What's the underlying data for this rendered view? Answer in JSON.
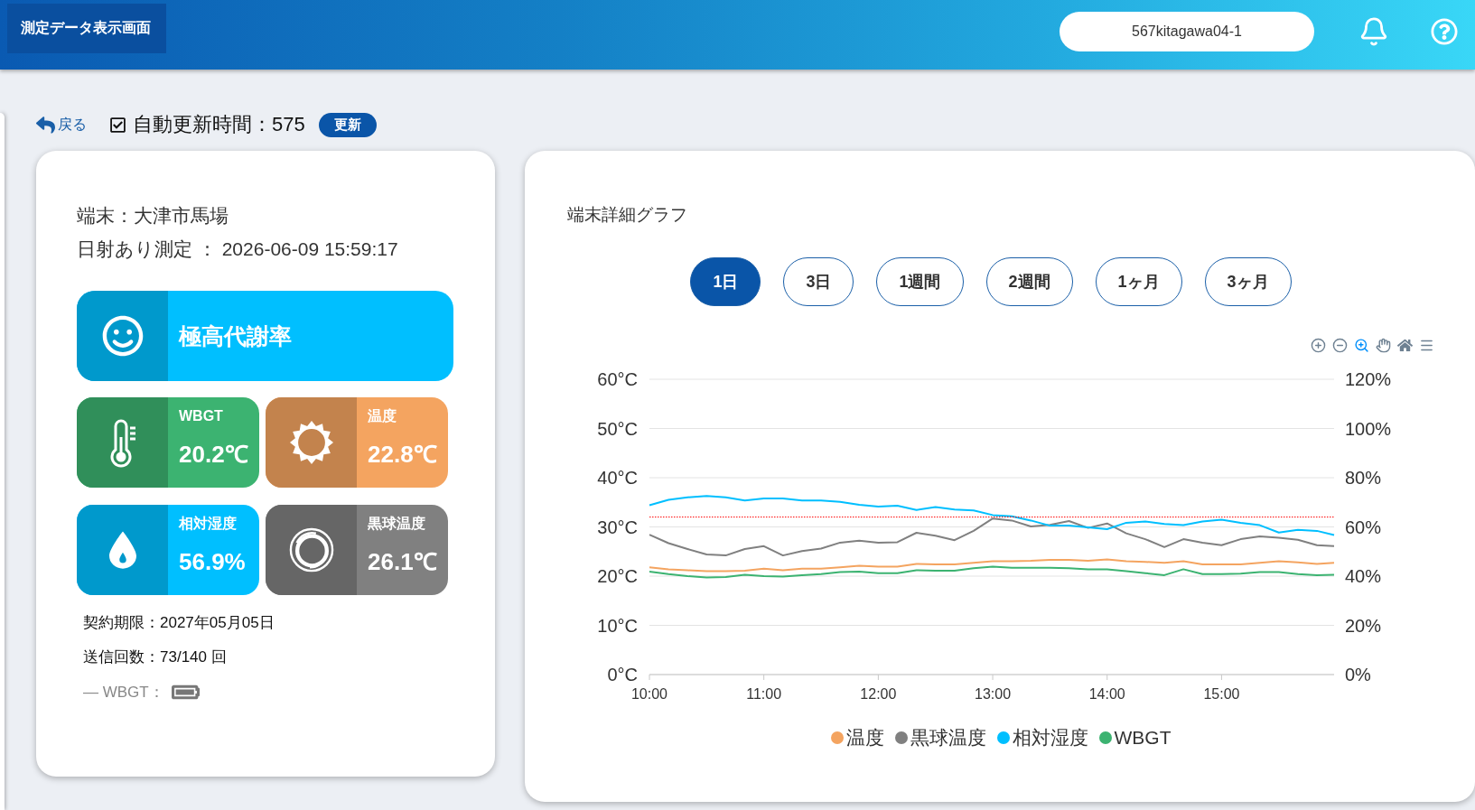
{
  "header": {
    "title": "測定データ表示画面",
    "user": "567kitagawa04-1"
  },
  "toolbar": {
    "back": "戻る",
    "auto_update": {
      "label": "自動更新時間：575",
      "checked": true
    },
    "refresh": "更新"
  },
  "device_card": {
    "lines": [
      "端末：大津市馬場",
      "日射あり測定 ： 2026-06-09 15:59:17"
    ],
    "status": {
      "label": "極高代謝率"
    },
    "metrics": [
      {
        "kind": "wbgt",
        "label": "WBGT",
        "value": "20.2℃",
        "color": "#3cb371"
      },
      {
        "kind": "temperature",
        "label": "温度",
        "value": "22.8℃",
        "color": "#f4a460"
      },
      {
        "kind": "humidity",
        "label": "相対湿度",
        "value": "56.9%",
        "color": "#00bfff"
      },
      {
        "kind": "globe",
        "label": "黒球温度",
        "value": "26.1℃",
        "color": "#808080"
      }
    ],
    "info": [
      "契約期限：2027年05月05日",
      "送信回数：73/140 回"
    ],
    "battery_label": "— WBGT："
  },
  "graph_card": {
    "title": "端末詳細グラフ",
    "ranges": [
      {
        "label": "1日",
        "selected": true
      },
      {
        "label": "3日",
        "selected": false
      },
      {
        "label": "1週間",
        "selected": false
      },
      {
        "label": "2週間",
        "selected": false
      },
      {
        "label": "1ヶ月",
        "selected": false
      },
      {
        "label": "3ヶ月",
        "selected": false
      }
    ],
    "tools": [
      {
        "kind": "zoom-in",
        "selected": false
      },
      {
        "kind": "zoom-out",
        "selected": false
      },
      {
        "kind": "zoom",
        "selected": true
      },
      {
        "kind": "pan",
        "selected": false
      },
      {
        "kind": "home",
        "selected": false
      },
      {
        "kind": "menu",
        "selected": false
      }
    ],
    "chart_data": {
      "type": "line",
      "x": [
        600,
        610,
        620,
        630,
        640,
        650,
        660,
        670,
        680,
        690,
        700,
        710,
        720,
        730,
        740,
        750,
        760,
        770,
        780,
        790,
        800,
        810,
        820,
        830,
        840,
        850,
        860,
        870,
        880,
        890,
        900,
        910,
        920,
        930,
        940,
        950,
        959
      ],
      "xlim": [
        600,
        959
      ],
      "xticks": [
        {
          "value": 600,
          "label": "10:00"
        },
        {
          "value": 660,
          "label": "11:00"
        },
        {
          "value": 720,
          "label": "12:00"
        },
        {
          "value": 780,
          "label": "13:00"
        },
        {
          "value": 840,
          "label": "14:00"
        },
        {
          "value": 900,
          "label": "15:00"
        }
      ],
      "ylim": [
        0,
        60
      ],
      "yticks": [
        {
          "value": 60,
          "label": "60°C"
        },
        {
          "value": 50,
          "label": "50°C"
        },
        {
          "value": 40,
          "label": "40°C"
        },
        {
          "value": 30,
          "label": "30°C"
        },
        {
          "value": 20,
          "label": "20°C"
        },
        {
          "value": 10,
          "label": "10°C"
        },
        {
          "value": 0,
          "label": "0°C"
        }
      ],
      "y2lim": [
        0,
        120
      ],
      "y2ticks": [
        {
          "value": 120,
          "label": "120%"
        },
        {
          "value": 100,
          "label": "100%"
        },
        {
          "value": 80,
          "label": "80%"
        },
        {
          "value": 60,
          "label": "60%"
        },
        {
          "value": 40,
          "label": "40%"
        },
        {
          "value": 20,
          "label": "20%"
        },
        {
          "value": 0,
          "label": "0%"
        }
      ],
      "grid": true,
      "legend": "bottom",
      "series": [
        {
          "name": "温度",
          "color": "#f4a460",
          "values": [
            21.8,
            21.4,
            21.2,
            21.0,
            21.0,
            21.1,
            21.5,
            21.2,
            21.5,
            21.5,
            21.8,
            22.1,
            21.9,
            21.9,
            22.5,
            22.4,
            22.4,
            22.7,
            23.0,
            23.0,
            23.1,
            23.3,
            23.3,
            23.1,
            23.4,
            23.0,
            22.9,
            22.7,
            23.0,
            22.4,
            22.4,
            22.4,
            22.7,
            23.0,
            22.8,
            22.5,
            22.7
          ]
        },
        {
          "name": "黒球温度",
          "color": "#808080",
          "values": [
            28.4,
            26.7,
            25.5,
            24.4,
            24.2,
            25.5,
            26.1,
            24.2,
            25.1,
            25.6,
            26.8,
            27.2,
            26.8,
            26.9,
            28.8,
            28.2,
            27.3,
            29.2,
            31.7,
            31.3,
            30.1,
            30.4,
            31.2,
            29.8,
            30.7,
            28.7,
            27.5,
            25.9,
            27.5,
            26.8,
            26.3,
            27.5,
            28.1,
            27.8,
            27.4,
            26.3,
            26.1
          ]
        },
        {
          "name": "相対湿度",
          "color": "#00bfff",
          "axis": "y2",
          "values": [
            68.8,
            71.0,
            72.0,
            72.6,
            72.0,
            70.7,
            71.6,
            71.6,
            70.7,
            70.7,
            70.2,
            69.0,
            68.3,
            68.6,
            66.9,
            68.1,
            67.1,
            66.7,
            64.8,
            64.3,
            62.6,
            60.5,
            60.5,
            59.8,
            59.1,
            61.7,
            62.2,
            61.2,
            60.7,
            62.2,
            62.9,
            61.7,
            60.7,
            57.7,
            58.8,
            58.4,
            56.7
          ]
        },
        {
          "name": "WBGT",
          "color": "#3cb371",
          "values": [
            20.9,
            20.4,
            20.0,
            19.7,
            19.8,
            20.3,
            20.0,
            19.9,
            20.2,
            20.4,
            20.8,
            20.9,
            20.6,
            20.6,
            21.2,
            21.1,
            21.1,
            21.6,
            21.9,
            21.7,
            21.7,
            21.7,
            21.6,
            21.4,
            21.4,
            21.0,
            20.6,
            20.2,
            21.4,
            20.4,
            20.4,
            20.5,
            20.8,
            20.8,
            20.4,
            20.2,
            20.3
          ]
        }
      ],
      "ref_lines": [
        {
          "axis": "y",
          "value": 32,
          "color": "#ff0000"
        }
      ]
    }
  }
}
